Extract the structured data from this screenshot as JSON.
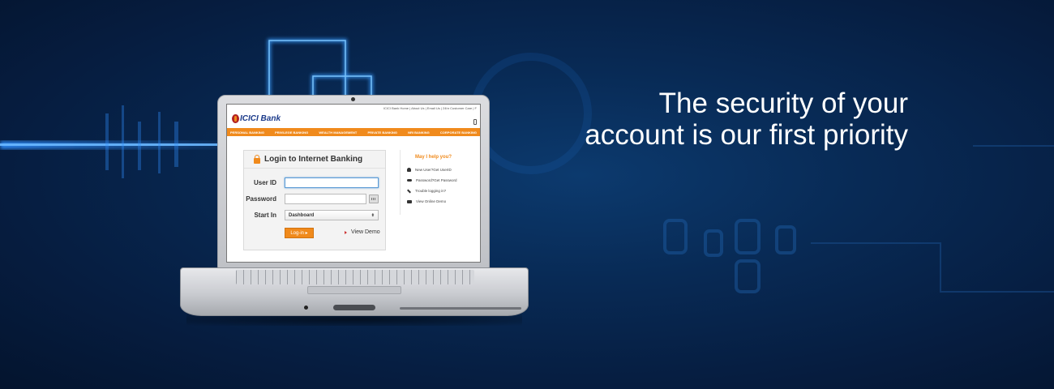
{
  "headline": {
    "line1": "The security of your",
    "line2": "account is our first priority"
  },
  "website": {
    "top_links": "ICICI Bank Home  |  About Us  |  Email Us  |  24hr Customer Care  |  F",
    "logo_text": "ICICI Bank",
    "nav": [
      "PERSONAL BANKING",
      "PRIVILEGE BANKING",
      "WEALTH MANAGEMENT",
      "PRIVATE BANKING",
      "NRI BANKING",
      "CORPORATE BANKING"
    ],
    "login": {
      "title": "Login to Internet Banking",
      "user_id_label": "User ID",
      "user_id_value": "",
      "password_label": "Password",
      "password_value": "",
      "start_in_label": "Start In",
      "start_in_selected": "Dashboard",
      "login_button": "Log-in",
      "view_demo": "View Demo"
    },
    "help": {
      "title": "May I help you?",
      "items": [
        {
          "label": "New User?Get UserID",
          "icon": "user-icon"
        },
        {
          "label": "Password?Get Password",
          "icon": "key-icon"
        },
        {
          "label": "Trouble logging in?",
          "icon": "tools-icon"
        },
        {
          "label": "View Online Demo",
          "icon": "demo-icon"
        }
      ]
    }
  },
  "colors": {
    "brand_orange": "#f08a1c",
    "brand_blue": "#1b3a8a",
    "background": "#082a55"
  }
}
